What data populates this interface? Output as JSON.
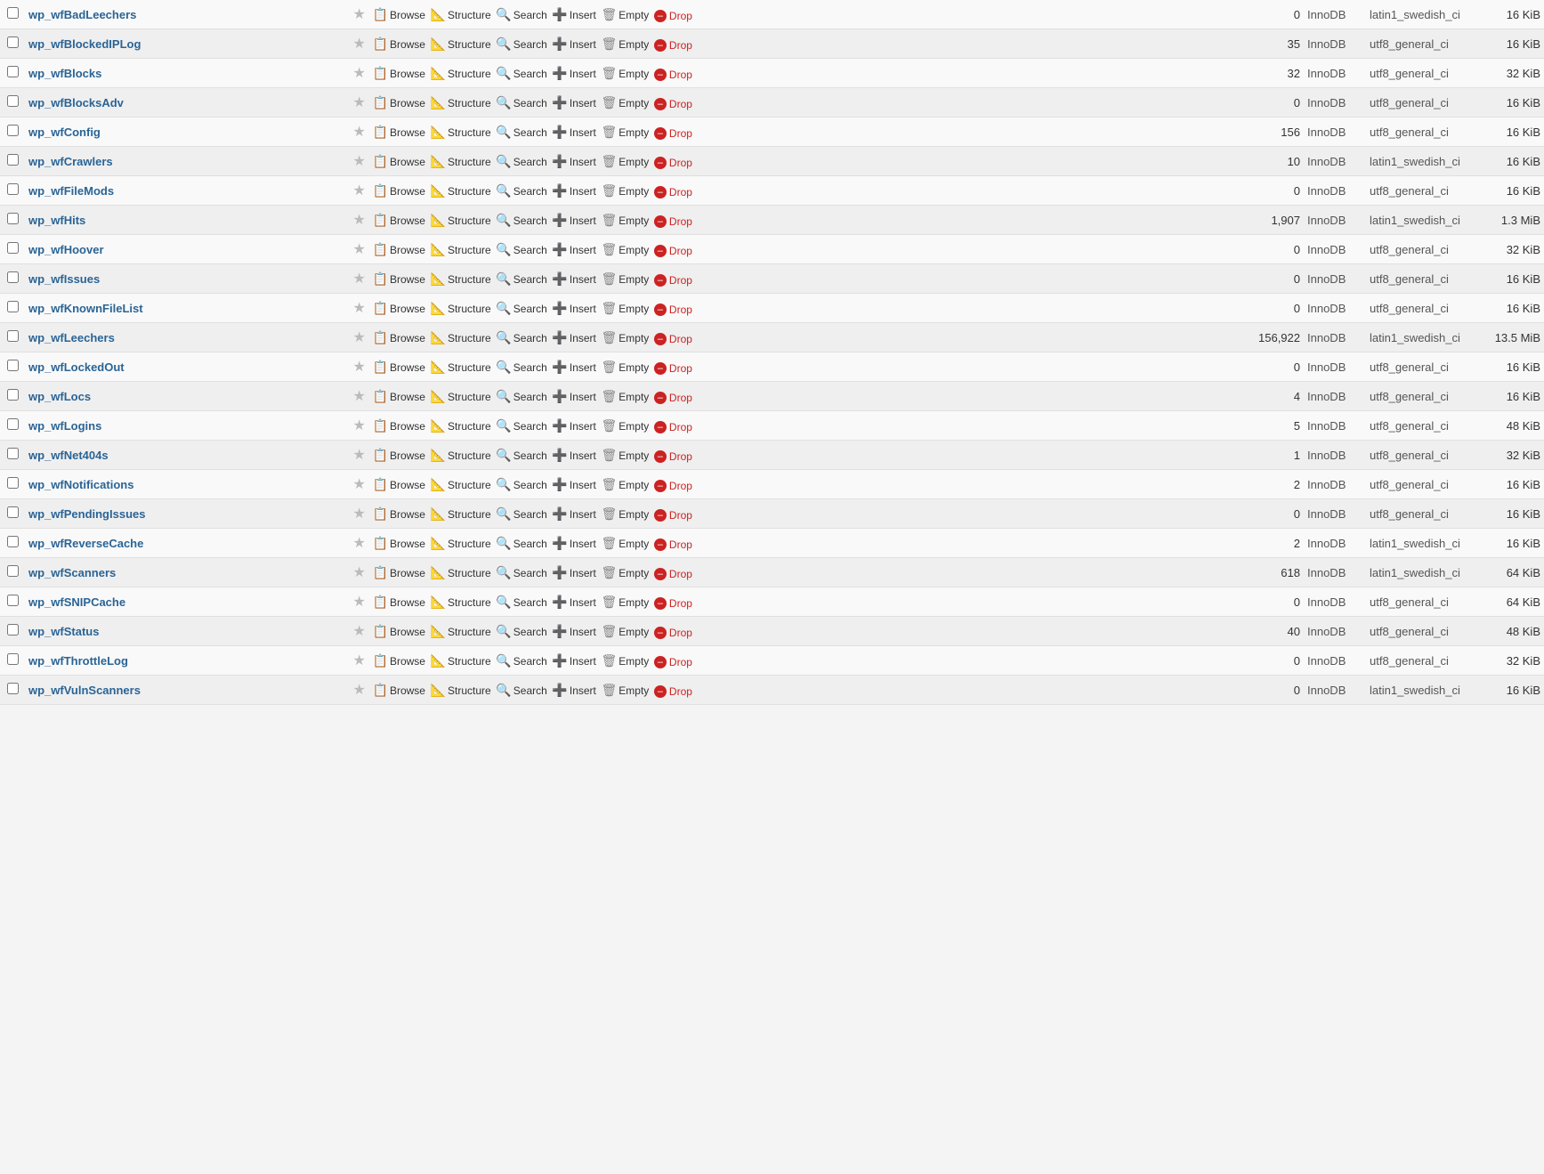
{
  "tables": [
    {
      "name": "wp_wfBadLeechers",
      "rows": "0",
      "engine": "InnoDB",
      "collation": "latin1_swedish_ci",
      "size": "16 KiB"
    },
    {
      "name": "wp_wfBlockedIPLog",
      "rows": "35",
      "engine": "InnoDB",
      "collation": "utf8_general_ci",
      "size": "16 KiB"
    },
    {
      "name": "wp_wfBlocks",
      "rows": "32",
      "engine": "InnoDB",
      "collation": "utf8_general_ci",
      "size": "32 KiB"
    },
    {
      "name": "wp_wfBlocksAdv",
      "rows": "0",
      "engine": "InnoDB",
      "collation": "utf8_general_ci",
      "size": "16 KiB"
    },
    {
      "name": "wp_wfConfig",
      "rows": "156",
      "engine": "InnoDB",
      "collation": "utf8_general_ci",
      "size": "16 KiB"
    },
    {
      "name": "wp_wfCrawlers",
      "rows": "10",
      "engine": "InnoDB",
      "collation": "latin1_swedish_ci",
      "size": "16 KiB"
    },
    {
      "name": "wp_wfFileMods",
      "rows": "0",
      "engine": "InnoDB",
      "collation": "utf8_general_ci",
      "size": "16 KiB"
    },
    {
      "name": "wp_wfHits",
      "rows": "1,907",
      "engine": "InnoDB",
      "collation": "latin1_swedish_ci",
      "size": "1.3 MiB"
    },
    {
      "name": "wp_wfHoover",
      "rows": "0",
      "engine": "InnoDB",
      "collation": "utf8_general_ci",
      "size": "32 KiB"
    },
    {
      "name": "wp_wfIssues",
      "rows": "0",
      "engine": "InnoDB",
      "collation": "utf8_general_ci",
      "size": "16 KiB"
    },
    {
      "name": "wp_wfKnownFileList",
      "rows": "0",
      "engine": "InnoDB",
      "collation": "utf8_general_ci",
      "size": "16 KiB"
    },
    {
      "name": "wp_wfLeechers",
      "rows": "156,922",
      "engine": "InnoDB",
      "collation": "latin1_swedish_ci",
      "size": "13.5 MiB"
    },
    {
      "name": "wp_wfLockedOut",
      "rows": "0",
      "engine": "InnoDB",
      "collation": "utf8_general_ci",
      "size": "16 KiB"
    },
    {
      "name": "wp_wfLocs",
      "rows": "4",
      "engine": "InnoDB",
      "collation": "utf8_general_ci",
      "size": "16 KiB"
    },
    {
      "name": "wp_wfLogins",
      "rows": "5",
      "engine": "InnoDB",
      "collation": "utf8_general_ci",
      "size": "48 KiB"
    },
    {
      "name": "wp_wfNet404s",
      "rows": "1",
      "engine": "InnoDB",
      "collation": "utf8_general_ci",
      "size": "32 KiB"
    },
    {
      "name": "wp_wfNotifications",
      "rows": "2",
      "engine": "InnoDB",
      "collation": "utf8_general_ci",
      "size": "16 KiB"
    },
    {
      "name": "wp_wfPendingIssues",
      "rows": "0",
      "engine": "InnoDB",
      "collation": "utf8_general_ci",
      "size": "16 KiB"
    },
    {
      "name": "wp_wfReverseCache",
      "rows": "2",
      "engine": "InnoDB",
      "collation": "latin1_swedish_ci",
      "size": "16 KiB"
    },
    {
      "name": "wp_wfScanners",
      "rows": "618",
      "engine": "InnoDB",
      "collation": "latin1_swedish_ci",
      "size": "64 KiB"
    },
    {
      "name": "wp_wfSNIPCache",
      "rows": "0",
      "engine": "InnoDB",
      "collation": "utf8_general_ci",
      "size": "64 KiB"
    },
    {
      "name": "wp_wfStatus",
      "rows": "40",
      "engine": "InnoDB",
      "collation": "utf8_general_ci",
      "size": "48 KiB"
    },
    {
      "name": "wp_wfThrottleLog",
      "rows": "0",
      "engine": "InnoDB",
      "collation": "utf8_general_ci",
      "size": "32 KiB"
    },
    {
      "name": "wp_wfVulnScanners",
      "rows": "0",
      "engine": "InnoDB",
      "collation": "latin1_swedish_ci",
      "size": "16 KiB"
    }
  ],
  "actions": {
    "browse": "Browse",
    "structure": "Structure",
    "search": "Search",
    "insert": "Insert",
    "empty": "Empty",
    "drop": "Drop"
  }
}
